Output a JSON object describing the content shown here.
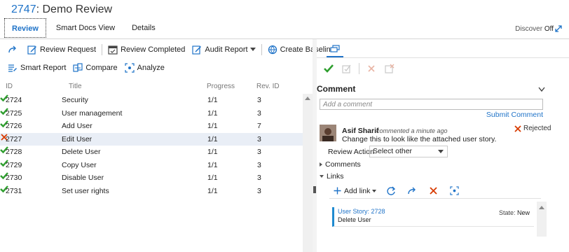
{
  "header": {
    "id": "2747",
    "separator": ":",
    "name": "Demo Review"
  },
  "tabs": [
    {
      "label": "Review",
      "active": true
    },
    {
      "label": "Smart Docs View",
      "active": false
    },
    {
      "label": "Details",
      "active": false
    }
  ],
  "discover": {
    "label": "Discover",
    "value": "Off"
  },
  "toolbar1": {
    "review_request": "Review Request",
    "review_completed": "Review Completed",
    "audit_report": "Audit Report",
    "create_baseline": "Create Baseline"
  },
  "toolbar2": {
    "smart_report": "Smart Report",
    "compare": "Compare",
    "analyze": "Analyze"
  },
  "grid": {
    "columns": [
      "ID",
      "Title",
      "Progress",
      "Rev. ID"
    ],
    "rows": [
      {
        "id": "2724",
        "status": "approved",
        "title": "Security",
        "progress": "1/1",
        "rev": "3"
      },
      {
        "id": "2725",
        "status": "approved",
        "title": "User management",
        "progress": "1/1",
        "rev": "3"
      },
      {
        "id": "2726",
        "status": "approved",
        "title": "Add User",
        "progress": "1/1",
        "rev": "7"
      },
      {
        "id": "2727",
        "status": "rejected",
        "title": "Edit User",
        "progress": "1/1",
        "rev": "3"
      },
      {
        "id": "2728",
        "status": "approved",
        "title": "Delete User",
        "progress": "1/1",
        "rev": "3"
      },
      {
        "id": "2729",
        "status": "approved",
        "title": "Copy User",
        "progress": "1/1",
        "rev": "3"
      },
      {
        "id": "2730",
        "status": "approved",
        "title": "Disable User",
        "progress": "1/1",
        "rev": "3"
      },
      {
        "id": "2731",
        "status": "approved",
        "title": "Set user rights",
        "progress": "1/1",
        "rev": "3"
      }
    ]
  },
  "comment": {
    "heading": "Comment",
    "placeholder": "Add a comment",
    "submit": "Submit Comment",
    "author": "Asif Sharif",
    "when": "commented a minute ago",
    "status": "Rejected",
    "text": "Change this to look like the attached user story.",
    "review_action_label": "Review Action",
    "review_action_value": "Select other",
    "comments_section": "Comments",
    "links_section": "Links",
    "add_link": "Add link"
  },
  "links": [
    {
      "title": "User Story: 2728",
      "subtitle": "Delete User",
      "state_label": "State:",
      "state_value": "New"
    }
  ],
  "colors": {
    "accent": "#1f73c8",
    "approve": "#2e9e2e",
    "reject": "#d83b01",
    "link_bar": "#1f8ad0"
  }
}
